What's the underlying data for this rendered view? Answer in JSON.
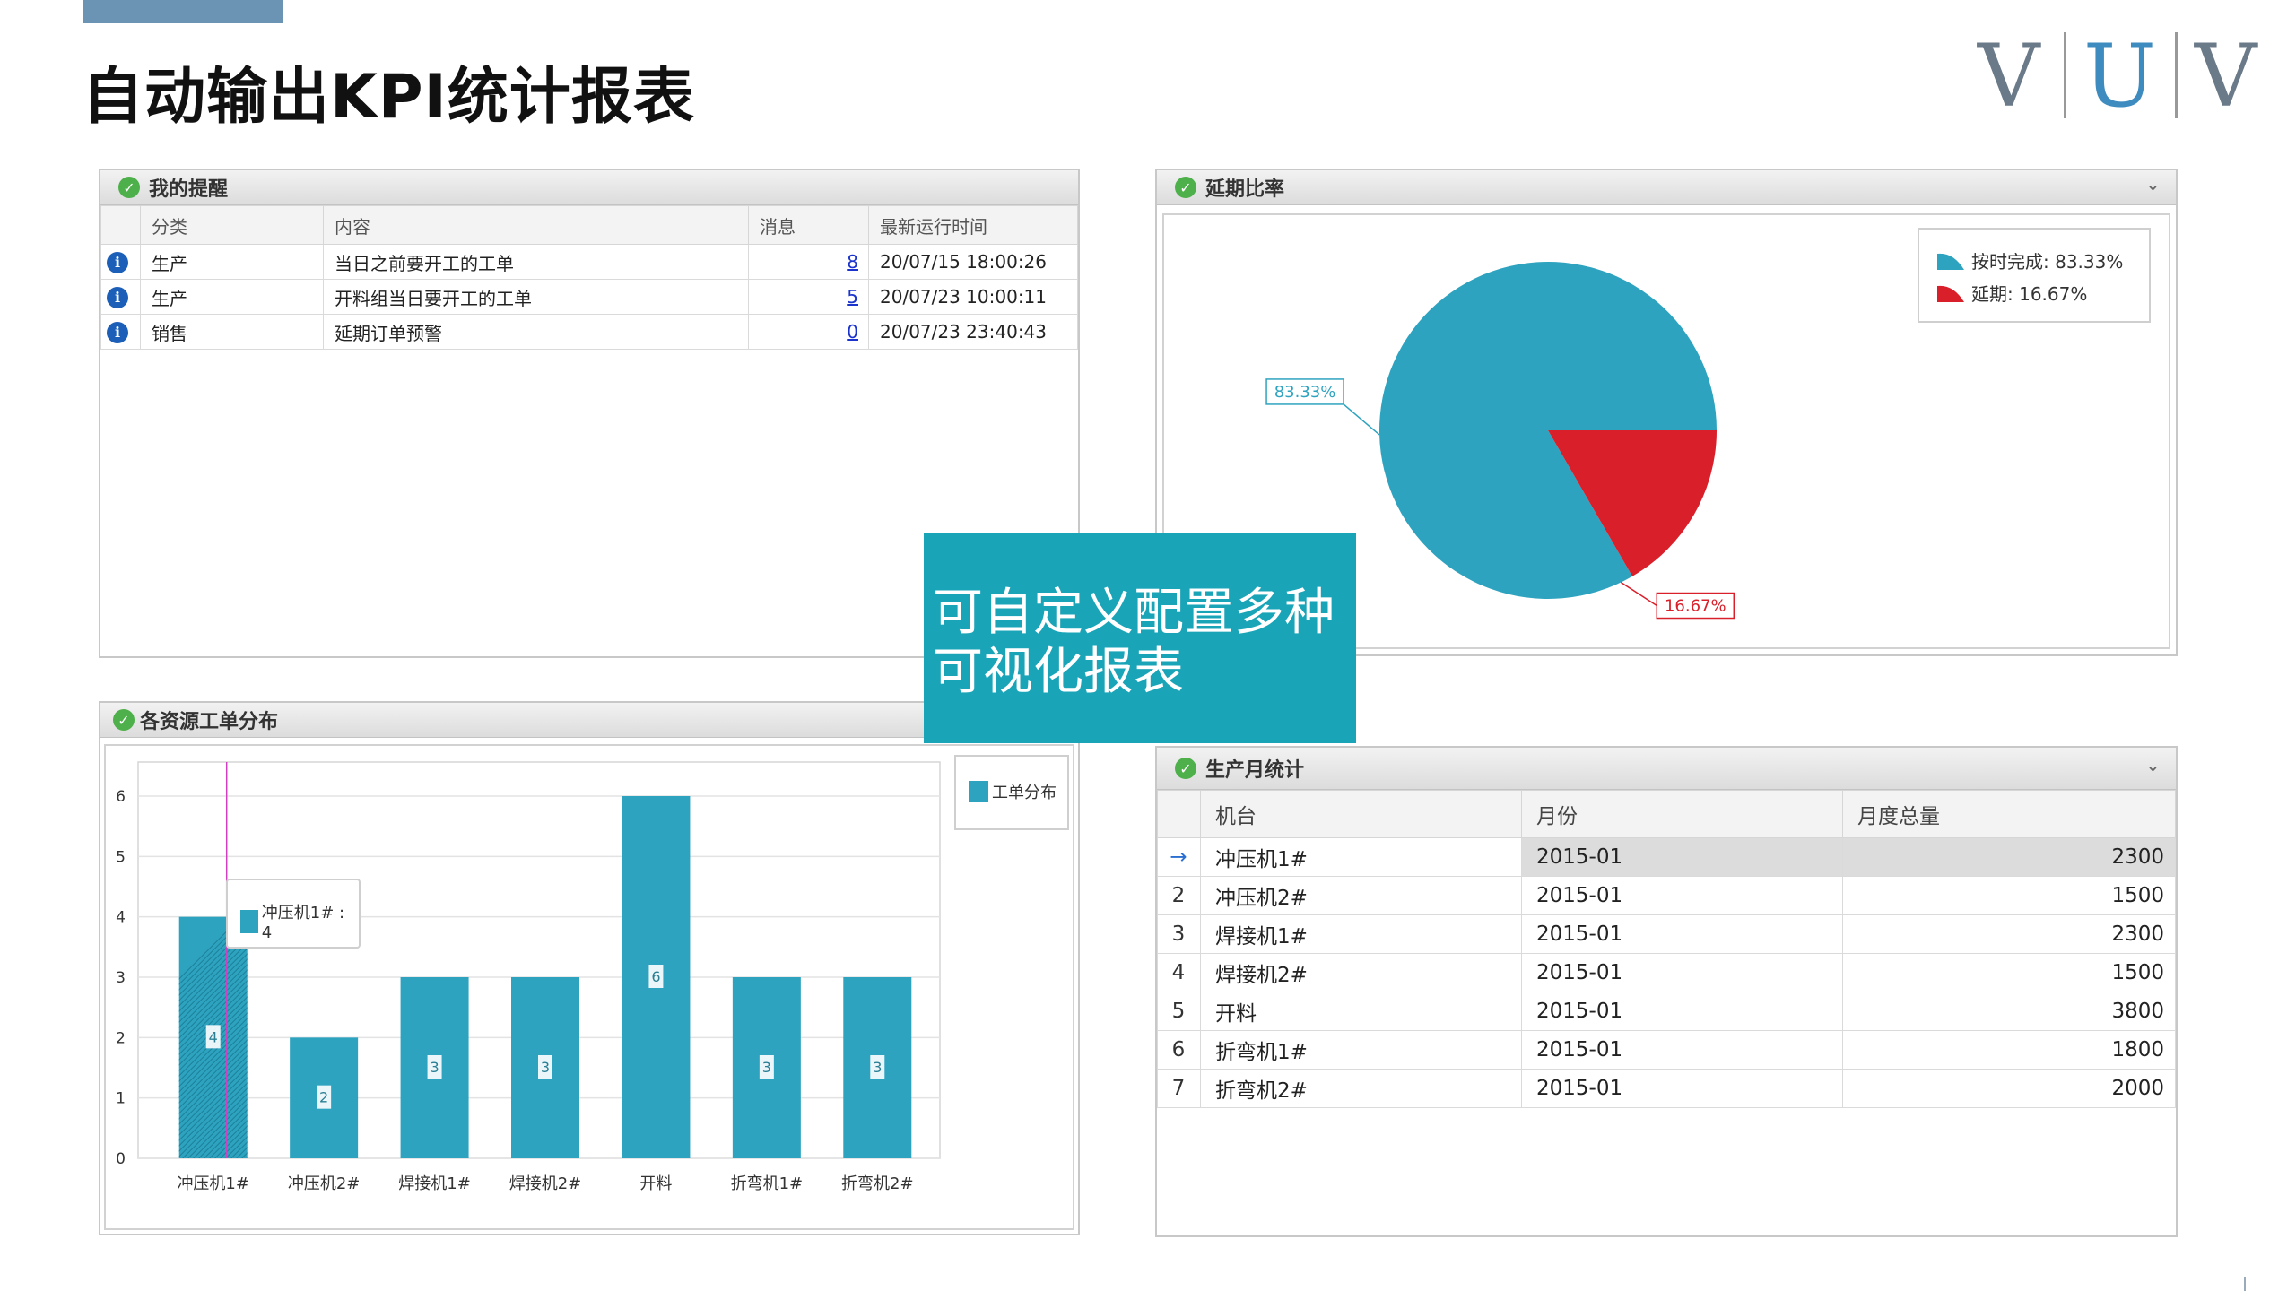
{
  "header": {
    "title": "自动输出KPI统计报表",
    "logo_letters": [
      "V",
      "U",
      "V"
    ]
  },
  "colors": {
    "accent": "#1aa4b8",
    "bar": "#2ea3bf",
    "pie_main": "#2ea3bf",
    "pie_red": "#d91f2a",
    "topbar": "#6b93b4"
  },
  "reminders": {
    "title": "我的提醒",
    "columns": [
      "分类",
      "内容",
      "消息",
      "最新运行时间"
    ],
    "rows": [
      {
        "category": "生产",
        "content": "当日之前要开工的工单",
        "count": "8",
        "time": "20/07/15 18:00:26"
      },
      {
        "category": "生产",
        "content": "开料组当日要开工的工单",
        "count": "5",
        "time": "20/07/23 10:00:11"
      },
      {
        "category": "销售",
        "content": "延期订单预警",
        "count": "0",
        "time": "20/07/23 23:40:43"
      }
    ]
  },
  "delay_panel": {
    "title": "延期比率",
    "legend": [
      "按时完成: 83.33%",
      "延期: 16.67%"
    ],
    "label_main": "83.33%",
    "label_red": "16.67%"
  },
  "overlay": {
    "line1": "可自定义配置多种",
    "line2": "可视化报表"
  },
  "resource_panel": {
    "title": "各资源工单分布",
    "legend": "工单分布",
    "tooltip": "冲压机1# : 4"
  },
  "monthly_panel": {
    "title": "生产月统计",
    "columns": [
      "机台",
      "月份",
      "月度总量"
    ],
    "current_row_marker": "→",
    "rows": [
      {
        "idx": "",
        "machine": "冲压机1#",
        "month": "2015-01",
        "total": "2300"
      },
      {
        "idx": "2",
        "machine": "冲压机2#",
        "month": "2015-01",
        "total": "1500"
      },
      {
        "idx": "3",
        "machine": "焊接机1#",
        "month": "2015-01",
        "total": "2300"
      },
      {
        "idx": "4",
        "machine": "焊接机2#",
        "month": "2015-01",
        "total": "1500"
      },
      {
        "idx": "5",
        "machine": "开料",
        "month": "2015-01",
        "total": "3800"
      },
      {
        "idx": "6",
        "machine": "折弯机1#",
        "month": "2015-01",
        "total": "1800"
      },
      {
        "idx": "7",
        "machine": "折弯机2#",
        "month": "2015-01",
        "total": "2000"
      }
    ]
  },
  "chart_data": [
    {
      "type": "pie",
      "categories": [
        "按时完成",
        "延期"
      ],
      "values": [
        83.33,
        16.67
      ],
      "legend_placement": "top-right"
    },
    {
      "type": "bar",
      "categories": [
        "冲压机1#",
        "冲压机2#",
        "焊接机1#",
        "焊接机2#",
        "开料",
        "折弯机1#",
        "折弯机2#"
      ],
      "values": [
        4,
        2,
        3,
        3,
        6,
        3,
        3
      ],
      "ylim": [
        0,
        6
      ],
      "yticks": [
        "0",
        "1",
        "2",
        "3",
        "4",
        "5",
        "6"
      ],
      "series": [
        {
          "name": "工单分布",
          "values": [
            4,
            2,
            3,
            3,
            6,
            3,
            3
          ]
        }
      ],
      "grid": true,
      "legend_placement": "top-right"
    }
  ]
}
